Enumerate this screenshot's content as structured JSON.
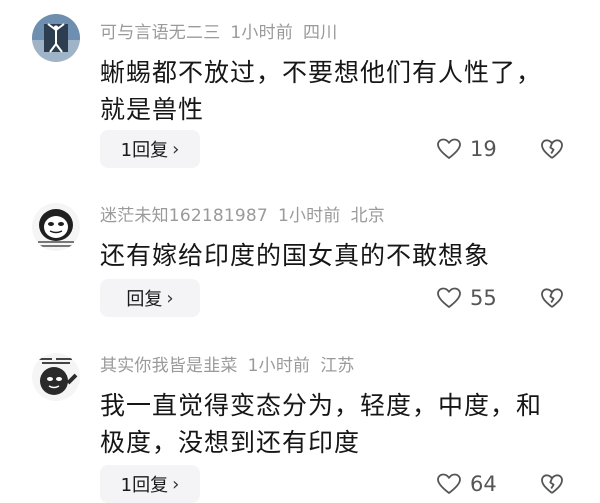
{
  "comments": [
    {
      "username": "可与言语无二三",
      "time": "1小时前",
      "location": "四川",
      "text_lines": [
        "蜥蜴都不放过，不要想他们有人性了，",
        "就是兽性"
      ],
      "reply_label": "1回复",
      "likes": "19",
      "icons": {
        "like": "heart-outline-icon",
        "dislike": "broken-heart-icon",
        "chevron": "chevron-right-icon"
      }
    },
    {
      "username": "迷茫未知162181987",
      "time": "1小时前",
      "location": "北京",
      "text_lines": [
        "还有嫁给印度的国女真的不敢想象"
      ],
      "reply_label": "回复",
      "likes": "55",
      "icons": {
        "like": "heart-outline-icon",
        "dislike": "broken-heart-icon",
        "chevron": "chevron-right-icon"
      }
    },
    {
      "username": "其实你我皆是韭菜",
      "time": "1小时前",
      "location": "江苏",
      "text_lines": [
        "我一直觉得变态分为，轻度，中度，和",
        "极度，没想到还有印度"
      ],
      "reply_label": "1回复",
      "likes": "64",
      "icons": {
        "like": "heart-outline-icon",
        "dislike": "broken-heart-icon",
        "chevron": "chevron-right-icon"
      }
    }
  ],
  "chevron_glyph": "›",
  "colors": {
    "meta": "#9a9a9a",
    "body": "#161616",
    "reply_bg": "#f4f4f6"
  }
}
